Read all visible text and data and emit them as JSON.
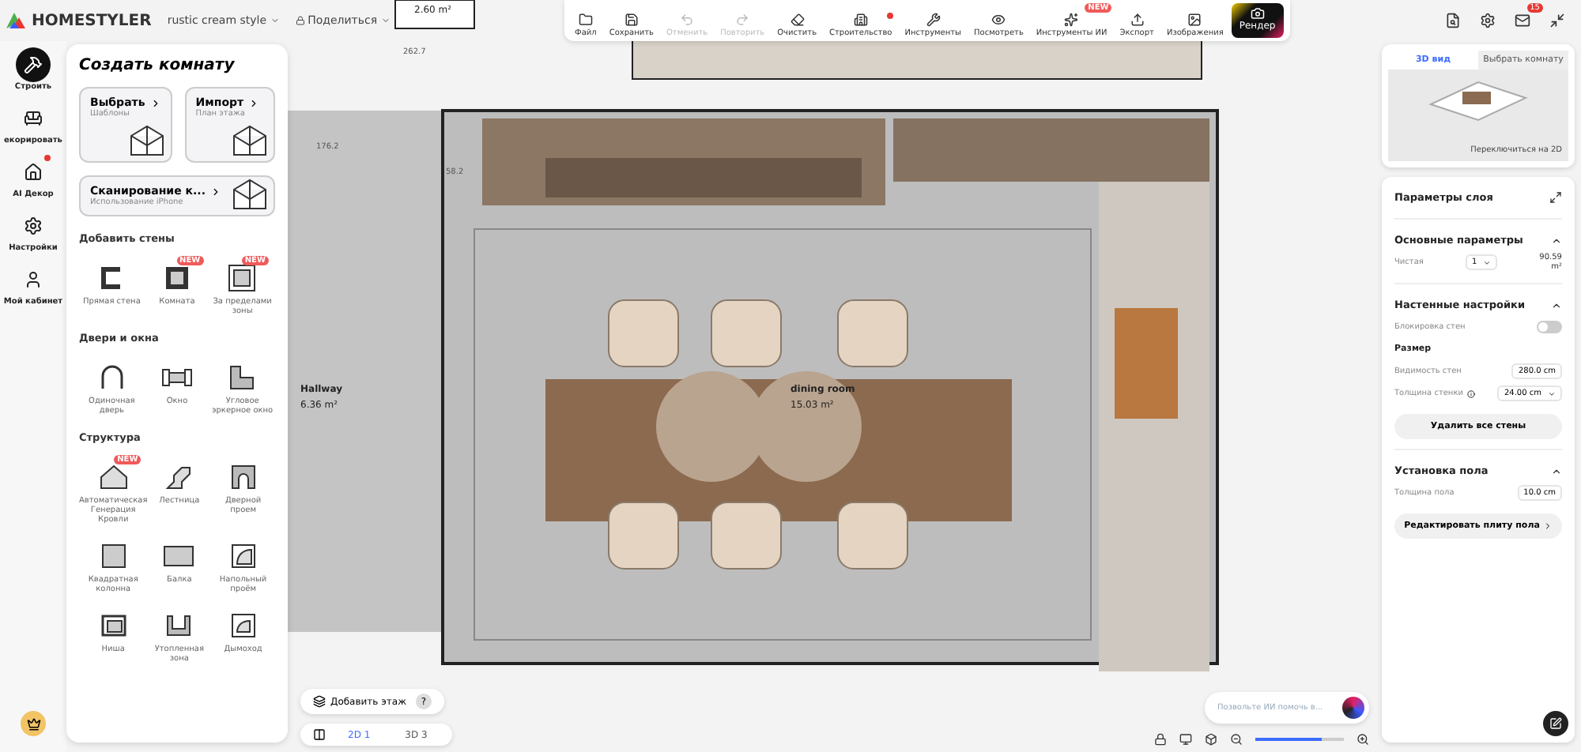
{
  "header": {
    "logo": "HOMESTYLER",
    "project": "rustic cream style",
    "share": "Поделиться"
  },
  "toolbar": [
    {
      "label": "Файл",
      "disabled": false,
      "dot": false
    },
    {
      "label": "Сохранить",
      "disabled": false,
      "dot": false
    },
    {
      "label": "Отменить",
      "disabled": true,
      "dot": false
    },
    {
      "label": "Повторить",
      "disabled": true,
      "dot": false
    },
    {
      "label": "Очистить",
      "disabled": false,
      "dot": false
    },
    {
      "label": "Строительство",
      "disabled": false,
      "dot": true
    },
    {
      "label": "Инструменты",
      "disabled": false,
      "dot": false
    },
    {
      "label": "Посмотреть",
      "disabled": false,
      "dot": false
    },
    {
      "label": "Инструменты ИИ",
      "disabled": false,
      "dot": false,
      "badge": "NEW"
    },
    {
      "label": "Экспорт",
      "disabled": false,
      "dot": false
    },
    {
      "label": "Изображения",
      "disabled": false,
      "dot": false
    }
  ],
  "render_button": "Рендер",
  "top_icons": {
    "mail_count": "15"
  },
  "rail": [
    {
      "label": "Строить",
      "selected": true,
      "dot": false
    },
    {
      "label": "екорировать",
      "selected": false,
      "dot": false
    },
    {
      "label": "AI Декор",
      "selected": false,
      "dot": true
    },
    {
      "label": "Настройки",
      "selected": false,
      "dot": false
    },
    {
      "label": "Мой кабинет",
      "selected": false,
      "dot": false
    }
  ],
  "panel": {
    "title": "Создать комнату",
    "cards": [
      {
        "title": "Выбрать",
        "subtitle": "Шаблоны",
        "wide": false
      },
      {
        "title": "Импорт",
        "subtitle": "План этажа",
        "wide": false
      },
      {
        "title": "Сканирование к...",
        "subtitle": "Использование iPhone",
        "wide": true
      }
    ],
    "sections": [
      {
        "title": "Добавить стены",
        "tools": [
          {
            "label": "Прямая стена"
          },
          {
            "label": "Комната",
            "badge": "NEW"
          },
          {
            "label": "За пределами зоны",
            "badge": "NEW"
          }
        ]
      },
      {
        "title": "Двери и окна",
        "tools": [
          {
            "label": "Одиночная дверь"
          },
          {
            "label": "Окно"
          },
          {
            "label": "Угловое эркерное окно"
          }
        ]
      },
      {
        "title": "Структура",
        "tools": [
          {
            "label": "Автоматическая Генерация Кровли",
            "badge": "NEW"
          },
          {
            "label": "Лестница"
          },
          {
            "label": "Дверной проем"
          },
          {
            "label": "Квадратная колонна"
          },
          {
            "label": "Балка"
          },
          {
            "label": "Напольный проём"
          },
          {
            "label": "Ниша"
          },
          {
            "label": "Утопленная зона"
          },
          {
            "label": "Дымоход"
          }
        ]
      }
    ]
  },
  "canvas": {
    "labels": [
      {
        "text": "2.60 m²",
        "kind": "area"
      },
      {
        "text": "262.7",
        "kind": "dim"
      },
      {
        "text": "176.2",
        "kind": "dim"
      },
      {
        "text": "58.2",
        "kind": "dim"
      },
      {
        "text": "Hallway",
        "kind": "room"
      },
      {
        "text": "6.36 m²",
        "kind": "area"
      },
      {
        "text": "dining room",
        "kind": "room"
      },
      {
        "text": "15.03 m²",
        "kind": "area"
      }
    ]
  },
  "bottom_left": {
    "add_floor": "Добавить этаж",
    "help": "?",
    "views": [
      {
        "label": "2D 1",
        "selected": true
      },
      {
        "label": "3D 3",
        "selected": false
      }
    ]
  },
  "ai_input": {
    "placeholder": "Позвольте ИИ помочь в..."
  },
  "zoom": {
    "level": 0.75
  },
  "view_card": {
    "tabs": [
      {
        "label": "3D вид",
        "selected": true
      },
      {
        "label": "Выбрать комнату",
        "selected": false
      }
    ],
    "switch": "Переключиться на 2D"
  },
  "properties": {
    "title": "Параметры слоя",
    "basic": {
      "title": "Основные параметры",
      "expanded": true,
      "label": "Чистая",
      "select": "1",
      "value": "90.59",
      "unit": "m²"
    },
    "walls": {
      "title": "Настенные настройки",
      "expanded": true,
      "lock_label": "Блокировка стен",
      "lock_on": false,
      "size_title": "Размер",
      "visibility_label": "Видимость стен",
      "visibility": "280.0",
      "visibility_unit": "cm",
      "thickness_label": "Толщина стенки",
      "thickness": "24.00",
      "thickness_unit": "cm",
      "delete_button": "Удалить все стены"
    },
    "floor": {
      "title": "Установка пола",
      "expanded": true,
      "thickness_label": "Толщина пола",
      "thickness": "10.0",
      "unit": "cm",
      "edit_button": "Редактировать плиту пола"
    }
  }
}
